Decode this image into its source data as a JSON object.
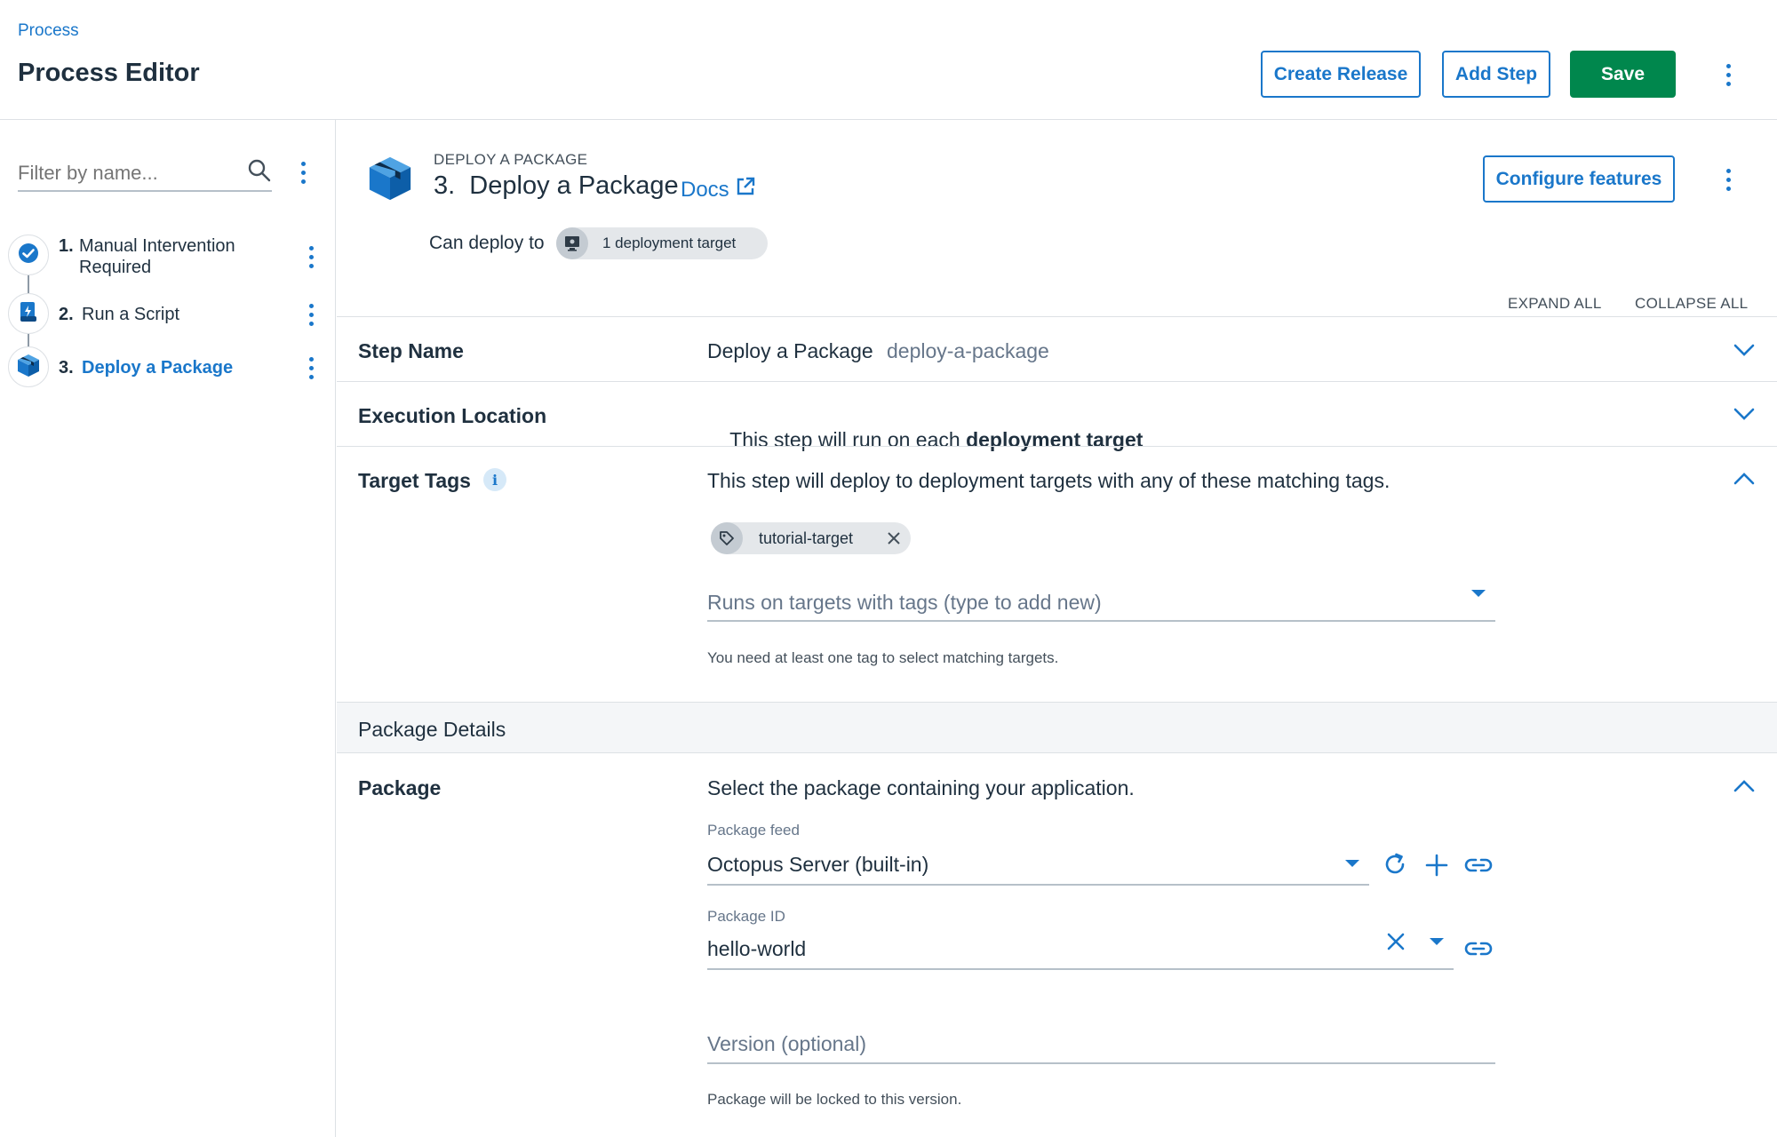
{
  "header": {
    "breadcrumb": "Process",
    "title": "Process Editor",
    "create_release": "Create Release",
    "add_step": "Add Step",
    "save": "Save"
  },
  "sidebar": {
    "filter_placeholder": "Filter by name...",
    "steps": [
      {
        "number": "1.",
        "label_line1": "Manual Intervention",
        "label_line2": "Required",
        "icon": "check-circle-icon"
      },
      {
        "number": "2.",
        "label": "Run a Script",
        "icon": "script-icon"
      },
      {
        "number": "3.",
        "label": "Deploy a Package",
        "icon": "package-icon",
        "active": true
      }
    ]
  },
  "step_header": {
    "kind": "DEPLOY A PACKAGE",
    "title": "3.  Deploy a Package",
    "docs": "Docs",
    "can_deploy_to": "Can deploy to",
    "targets_chip": "1 deployment target",
    "configure_features": "Configure features"
  },
  "controls": {
    "expand_all": "EXPAND ALL",
    "collapse_all": "COLLAPSE ALL"
  },
  "sections": {
    "step_name": {
      "label": "Step Name",
      "value": "Deploy a Package",
      "slug": "deploy-a-package"
    },
    "execution_location": {
      "label": "Execution Location",
      "text_prefix": "This step will run on each",
      "text_bold": "deployment target"
    },
    "target_tags": {
      "label": "Target Tags",
      "description": "This step will deploy to deployment targets with any of these matching tags.",
      "tag": "tutorial-target",
      "input_placeholder": "Runs on targets with tags (type to add new)",
      "hint": "You need at least one tag to select matching targets."
    },
    "package_details": {
      "label": "Package Details"
    },
    "package": {
      "label": "Package",
      "description": "Select the package containing your application.",
      "feed_label": "Package feed",
      "feed_value": "Octopus Server (built-in)",
      "id_label": "Package ID",
      "id_value": "hello-world",
      "version_placeholder": "Version (optional)",
      "version_hint": "Package will be locked to this version."
    }
  },
  "colors": {
    "accent": "#1a77ca",
    "save_green": "#00874d",
    "text": "#1f303f",
    "muted": "#66768a",
    "divider": "#dde1e5"
  }
}
